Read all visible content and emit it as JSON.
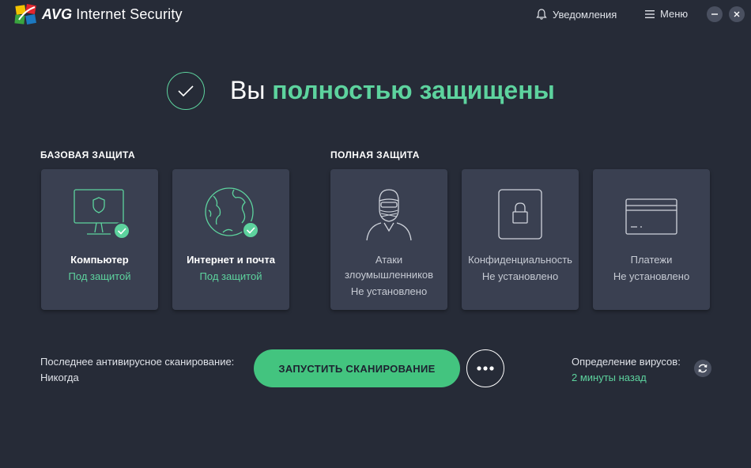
{
  "app": {
    "brand_bold": "AVG",
    "brand_rest": "Internet Security",
    "notifications_label": "Уведомления",
    "menu_label": "Меню"
  },
  "hero": {
    "prefix": "Вы",
    "accent": "полностью защищены"
  },
  "sections": {
    "basic": "БАЗОВАЯ ЗАЩИТА",
    "full": "ПОЛНАЯ ЗАЩИТА"
  },
  "cards": [
    {
      "title": "Компьютер",
      "status": "Под защитой",
      "icon": "monitor-shield-icon",
      "state": "protected"
    },
    {
      "title": "Интернет и почта",
      "status": "Под защитой",
      "icon": "globe-icon",
      "state": "protected"
    },
    {
      "title": "Атаки злоумышленников",
      "status": "Не установлено",
      "icon": "hacker-icon",
      "state": "not-installed"
    },
    {
      "title": "Конфиденциальность",
      "status": "Не установлено",
      "icon": "phone-lock-icon",
      "state": "not-installed"
    },
    {
      "title": "Платежи",
      "status": "Не установлено",
      "icon": "credit-card-icon",
      "state": "not-installed"
    }
  ],
  "scan": {
    "last_label": "Последнее антивирусное сканирование:",
    "last_value": "Никогда",
    "button_label": "ЗАПУСТИТЬ СКАНИРОВАНИЕ"
  },
  "definitions": {
    "label": "Определение вирусов:",
    "value": "2 минуты назад"
  },
  "colors": {
    "background": "#262b37",
    "card": "#3a4051",
    "accent_green": "#5dd39e",
    "button_green": "#43c47f"
  }
}
